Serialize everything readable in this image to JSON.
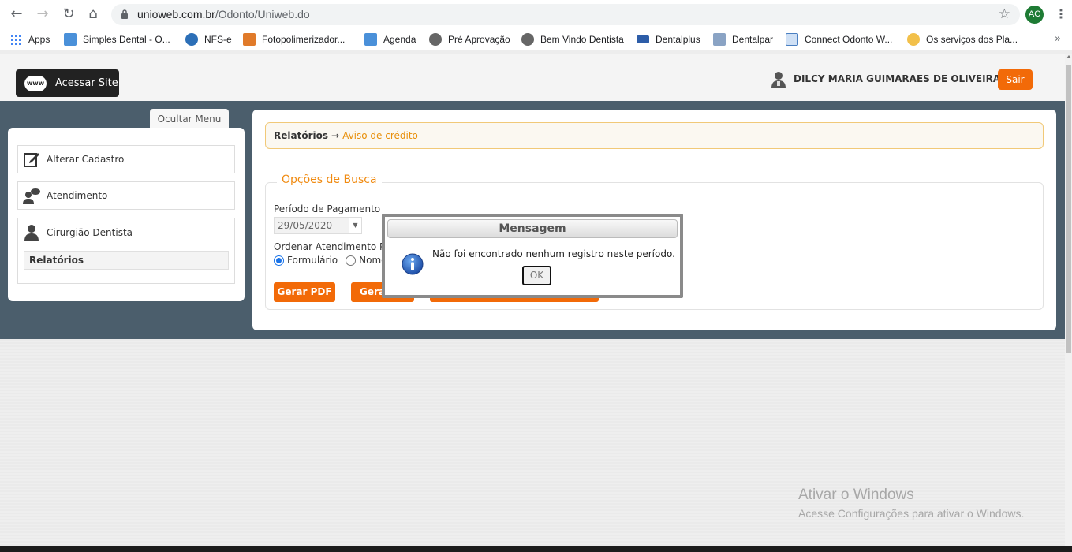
{
  "browser": {
    "url_host": "unioweb.com.br",
    "url_path": "/Odonto/Uniweb.do",
    "profile_initials": "AC",
    "bookmarks": [
      {
        "label": "Apps",
        "icon": "apps-grid-icon"
      },
      {
        "label": "Simples Dental - O...",
        "icon": "tooth-icon"
      },
      {
        "label": "NFS-e",
        "icon": "globe-icon"
      },
      {
        "label": "Fotopolimerizador...",
        "icon": "abs-icon"
      },
      {
        "label": "Agenda",
        "icon": "tooth-icon"
      },
      {
        "label": "Pré Aprovação",
        "icon": "globe-icon"
      },
      {
        "label": "Bem Vindo Dentista",
        "icon": "globe-icon"
      },
      {
        "label": "Dentalplus",
        "icon": "dentalplus-icon"
      },
      {
        "label": "Dentalpar",
        "icon": "dentalpar-icon"
      },
      {
        "label": "Connect Odonto W...",
        "icon": "shield-icon"
      },
      {
        "label": "Os serviços dos Pla...",
        "icon": "sun-icon"
      }
    ]
  },
  "header": {
    "site_button": "Acessar Site",
    "site_icon_text": "www",
    "user_name": "DILCY MARIA GUIMARAES DE OLIVEIRA",
    "logout": "Sair"
  },
  "sidebar": {
    "toggle": "Ocultar Menu",
    "items": [
      {
        "label": "Alterar Cadastro",
        "icon": "edit-icon"
      },
      {
        "label": "Atendimento",
        "icon": "chat-user-icon"
      },
      {
        "label": "Cirurgião Dentista",
        "icon": "doctor-icon"
      }
    ],
    "subitem": "Relatórios"
  },
  "breadcrumb": {
    "root": "Relatórios",
    "arrow": "→",
    "current": "Aviso de crédito"
  },
  "search": {
    "legend": "Opções de Busca",
    "period_label": "Período de Pagamento",
    "period_value": "29/05/2020",
    "order_label": "Ordenar Atendimento Po",
    "radio_options": [
      "Formulário",
      "Nome"
    ],
    "selected_radio": "Formulário",
    "buttons": [
      "Gerar PDF",
      "Gerar"
    ]
  },
  "dialog": {
    "title": "Mensagem",
    "message": "Não foi encontrado nenhum registro neste período.",
    "ok": "OK"
  },
  "watermark": {
    "title": "Ativar o Windows",
    "subtitle": "Acesse Configurações para ativar o Windows."
  },
  "colors": {
    "accent": "#f26a08",
    "link": "#e8900c",
    "band": "#4b5e6c"
  }
}
